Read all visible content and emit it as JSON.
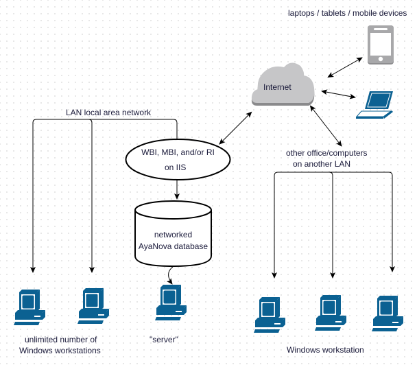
{
  "diagram": {
    "labels": {
      "devices": "laptops / tablets / mobile devices",
      "internet": "Internet",
      "lan": "LAN local area network",
      "iis_line1": "WBI, MBI, and/or RI",
      "iis_line2": "on IIS",
      "db_line1": "networked",
      "db_line2": "AyaNova database",
      "other_line1": "other office/computers",
      "other_line2": "on another LAN",
      "workstations_line1": "unlimited number of",
      "workstations_line2": "Windows workstations",
      "server": "\"server\"",
      "remote_workstation": "Windows workstation"
    },
    "nodes": [
      {
        "id": "internet",
        "type": "cloud",
        "icon": "cloud-icon"
      },
      {
        "id": "mobile",
        "type": "device",
        "icon": "smartphone-icon"
      },
      {
        "id": "laptop",
        "type": "device",
        "icon": "laptop-icon"
      },
      {
        "id": "iis",
        "type": "ellipse"
      },
      {
        "id": "database",
        "type": "cylinder",
        "icon": "database-icon"
      },
      {
        "id": "ws1",
        "type": "computer",
        "icon": "desktop-computer-icon"
      },
      {
        "id": "ws2",
        "type": "computer",
        "icon": "desktop-computer-icon"
      },
      {
        "id": "server",
        "type": "computer",
        "icon": "desktop-computer-icon"
      },
      {
        "id": "rws1",
        "type": "computer",
        "icon": "desktop-computer-icon"
      },
      {
        "id": "rws2",
        "type": "computer",
        "icon": "desktop-computer-icon"
      },
      {
        "id": "rws3",
        "type": "computer",
        "icon": "desktop-computer-icon"
      }
    ],
    "edges": [
      {
        "from": "internet",
        "to": "mobile",
        "direction": "both"
      },
      {
        "from": "internet",
        "to": "laptop",
        "direction": "both"
      },
      {
        "from": "internet",
        "to": "iis",
        "direction": "both"
      },
      {
        "from": "internet",
        "to": "other_lan",
        "direction": "both"
      },
      {
        "from": "iis",
        "to": "database",
        "direction": "forward"
      },
      {
        "from": "database",
        "to": "server",
        "direction": "forward"
      },
      {
        "from": "lan",
        "to": "ws1",
        "direction": "forward"
      },
      {
        "from": "lan",
        "to": "ws2",
        "direction": "forward"
      },
      {
        "from": "other_lan",
        "to": "rws1",
        "direction": "forward"
      },
      {
        "from": "other_lan",
        "to": "rws2",
        "direction": "forward"
      },
      {
        "from": "other_lan",
        "to": "rws3",
        "direction": "forward"
      }
    ],
    "colors": {
      "computer": "#0b6192",
      "cloud": "#c6c6c8",
      "cloud_shadow": "#8a8a8c",
      "device_gray": "#a8a8aa",
      "line": "#000000",
      "text": "#1a1a3a"
    }
  }
}
